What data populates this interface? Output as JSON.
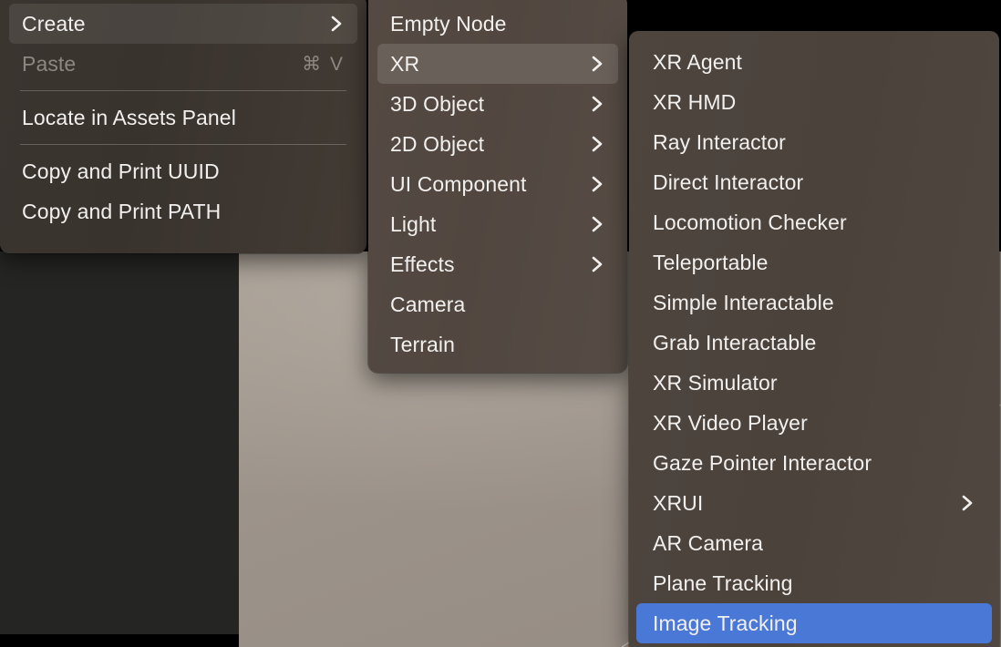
{
  "background": {
    "sidebar_name": "assets-sidebar",
    "viewport_name": "scene-viewport"
  },
  "menus": {
    "context_menu": {
      "name": "context-menu",
      "items": [
        {
          "label": "Create",
          "shortcut": "",
          "submenu": true,
          "state": "highlighted"
        },
        {
          "label": "Paste",
          "shortcut": "⌘ V",
          "submenu": false,
          "state": "disabled"
        },
        {
          "separator": true
        },
        {
          "label": "Locate in Assets Panel",
          "shortcut": "",
          "submenu": false,
          "state": "normal"
        },
        {
          "separator": true
        },
        {
          "label": "Copy and Print UUID",
          "shortcut": "",
          "submenu": false,
          "state": "normal"
        },
        {
          "label": "Copy and Print PATH",
          "shortcut": "",
          "submenu": false,
          "state": "normal"
        }
      ]
    },
    "create_submenu": {
      "name": "create-submenu",
      "items": [
        {
          "label": "Empty Node",
          "submenu": false,
          "state": "normal"
        },
        {
          "label": "XR",
          "submenu": true,
          "state": "highlighted"
        },
        {
          "label": "3D Object",
          "submenu": true,
          "state": "normal"
        },
        {
          "label": "2D Object",
          "submenu": true,
          "state": "normal"
        },
        {
          "label": "UI Component",
          "submenu": true,
          "state": "normal"
        },
        {
          "label": "Light",
          "submenu": true,
          "state": "normal"
        },
        {
          "label": "Effects",
          "submenu": true,
          "state": "normal"
        },
        {
          "label": "Camera",
          "submenu": false,
          "state": "normal"
        },
        {
          "label": "Terrain",
          "submenu": false,
          "state": "normal"
        }
      ]
    },
    "xr_submenu": {
      "name": "xr-submenu",
      "items": [
        {
          "label": "XR Agent",
          "submenu": false,
          "state": "normal"
        },
        {
          "label": "XR HMD",
          "submenu": false,
          "state": "normal"
        },
        {
          "label": "Ray Interactor",
          "submenu": false,
          "state": "normal"
        },
        {
          "label": "Direct Interactor",
          "submenu": false,
          "state": "normal"
        },
        {
          "label": "Locomotion Checker",
          "submenu": false,
          "state": "normal"
        },
        {
          "label": "Teleportable",
          "submenu": false,
          "state": "normal"
        },
        {
          "label": "Simple Interactable",
          "submenu": false,
          "state": "normal"
        },
        {
          "label": "Grab Interactable",
          "submenu": false,
          "state": "normal"
        },
        {
          "label": "XR Simulator",
          "submenu": false,
          "state": "normal"
        },
        {
          "label": "XR Video Player",
          "submenu": false,
          "state": "normal"
        },
        {
          "label": "Gaze Pointer Interactor",
          "submenu": false,
          "state": "normal"
        },
        {
          "label": "XRUI",
          "submenu": true,
          "state": "normal"
        },
        {
          "label": "AR Camera",
          "submenu": false,
          "state": "normal"
        },
        {
          "label": "Plane Tracking",
          "submenu": false,
          "state": "normal"
        },
        {
          "label": "Image Tracking",
          "submenu": false,
          "state": "selected"
        }
      ]
    }
  },
  "colors": {
    "selection_blue": "#4a78d6",
    "hover_warm": "#6a605a",
    "menu_dark": "#3b3530",
    "menu_mid": "#544a43",
    "menu_light": "#4e453f",
    "text": "#f2f0ee",
    "text_disabled": "#8d8781",
    "viewport": "#9b9289",
    "sidebar": "#252523"
  }
}
